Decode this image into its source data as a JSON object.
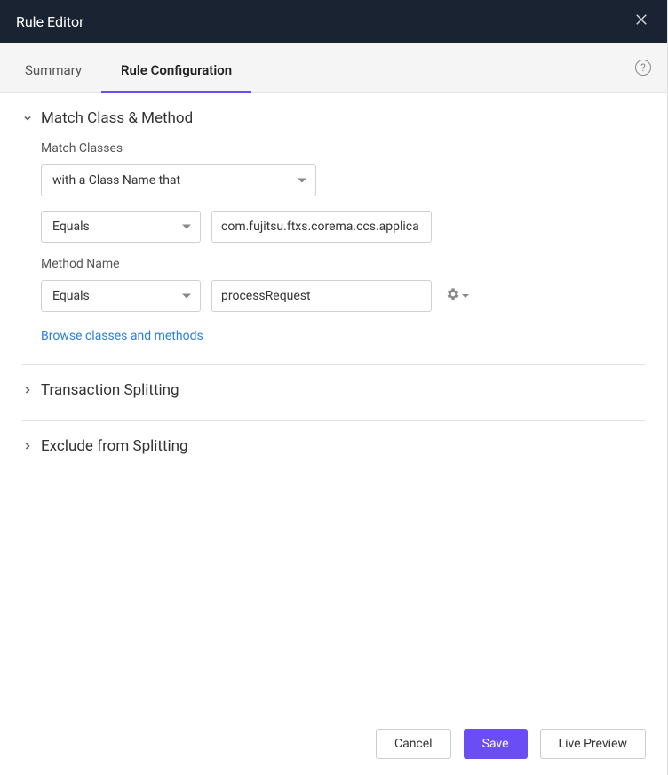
{
  "header": {
    "title": "Rule Editor"
  },
  "tabs": {
    "summary": "Summary",
    "rule_configuration": "Rule Configuration"
  },
  "sections": {
    "match": {
      "title": "Match Class & Method",
      "match_classes_label": "Match Classes",
      "class_name_selector": "with a Class Name that",
      "class_operator": "Equals",
      "class_value": "com.fujitsu.ftxs.corema.ccs.applica",
      "method_name_label": "Method Name",
      "method_operator": "Equals",
      "method_value": "processRequest",
      "browse_link": "Browse classes and methods"
    },
    "transaction_splitting": {
      "title": "Transaction Splitting"
    },
    "exclude_splitting": {
      "title": "Exclude from Splitting"
    }
  },
  "footer": {
    "cancel": "Cancel",
    "save": "Save",
    "live_preview": "Live Preview"
  }
}
